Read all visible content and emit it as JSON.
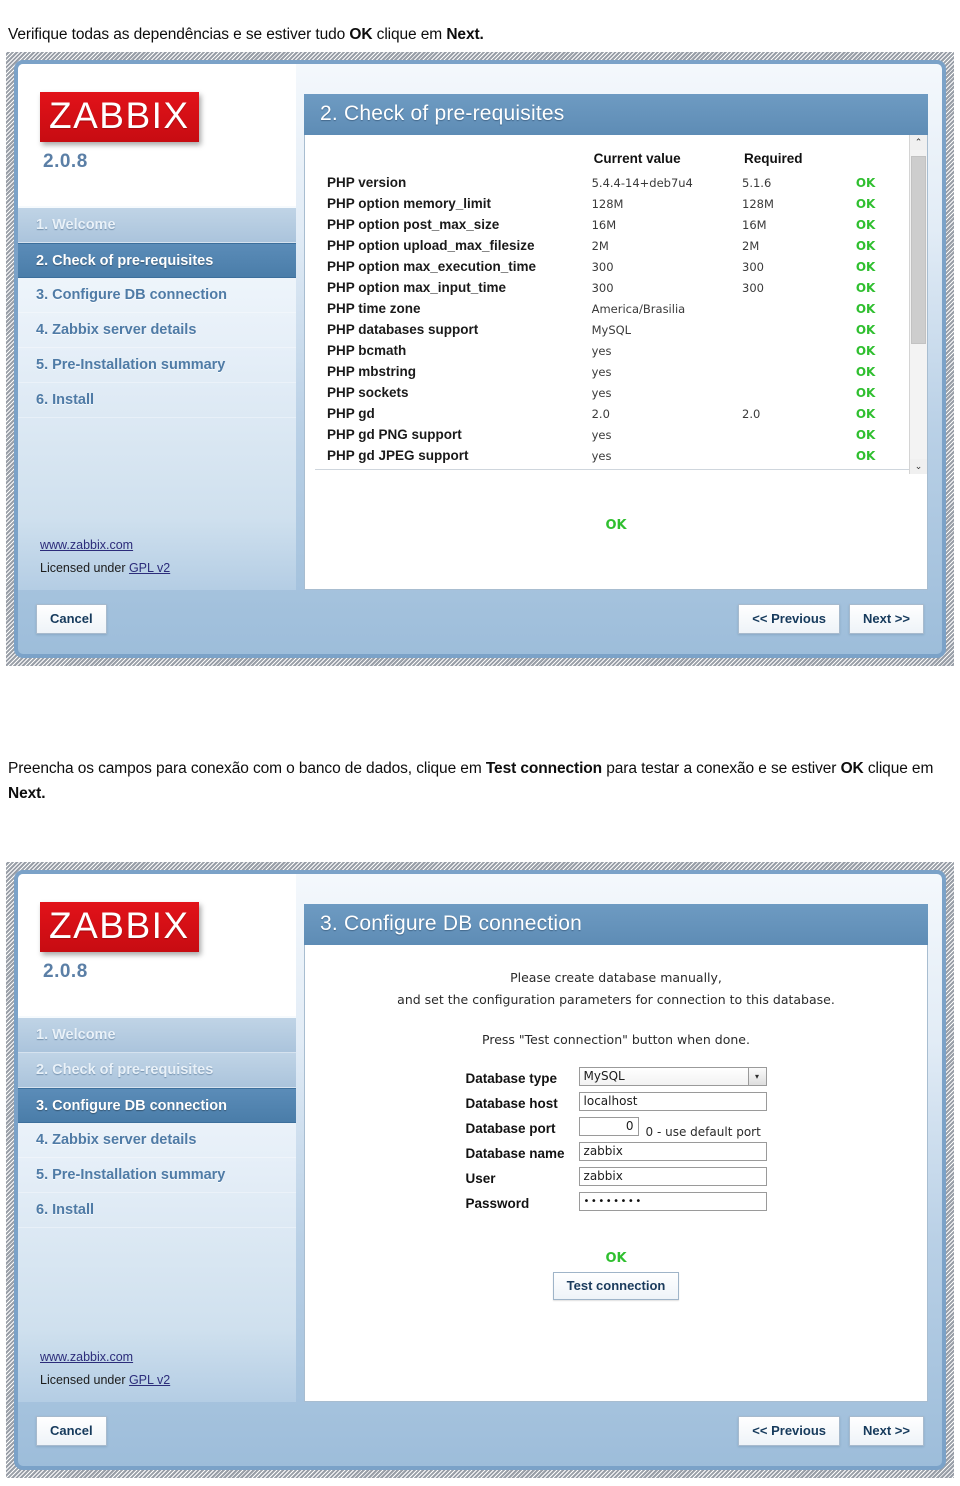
{
  "doc": {
    "para_top_part1": "Verifique todas as dependências e se estiver tudo ",
    "para_top_bold1": "OK",
    "para_top_part2": " clique em ",
    "para_top_bold2": "Next.",
    "para_mid_part1": "Preencha os campos para conexão com o banco de dados, clique em ",
    "para_mid_bold1": "Test connection",
    "para_mid_part2": " para testar a conexão e se estiver ",
    "para_mid_bold2": "OK",
    "para_mid_part3": " clique em ",
    "para_mid_bold3": "Next."
  },
  "brand": {
    "logo_text": "ZABBIX",
    "version": "2.0.8"
  },
  "footer_links": {
    "site": "www.zabbix.com",
    "license_prefix": "Licensed under ",
    "license_link": "GPL v2"
  },
  "buttons": {
    "cancel": "Cancel",
    "previous": "<< Previous",
    "next": "Next >>",
    "test_connection": "Test connection"
  },
  "nav_labels": [
    "1. Welcome",
    "2. Check of pre-requisites",
    "3. Configure DB connection",
    "4. Zabbix server details",
    "5. Pre-Installation summary",
    "6. Install"
  ],
  "window_prereq": {
    "title": "2. Check of pre-requisites",
    "active_index": 1,
    "columns": {
      "name": "",
      "current": "Current value",
      "required": "Required",
      "status": ""
    },
    "rows": [
      {
        "name": "PHP version",
        "current": "5.4.4-14+deb7u4",
        "required": "5.1.6",
        "status": "OK"
      },
      {
        "name": "PHP option memory_limit",
        "current": "128M",
        "required": "128M",
        "status": "OK"
      },
      {
        "name": "PHP option post_max_size",
        "current": "16M",
        "required": "16M",
        "status": "OK"
      },
      {
        "name": "PHP option upload_max_filesize",
        "current": "2M",
        "required": "2M",
        "status": "OK"
      },
      {
        "name": "PHP option max_execution_time",
        "current": "300",
        "required": "300",
        "status": "OK"
      },
      {
        "name": "PHP option max_input_time",
        "current": "300",
        "required": "300",
        "status": "OK"
      },
      {
        "name": "PHP time zone",
        "current": "America/Brasilia",
        "required": "",
        "status": "OK"
      },
      {
        "name": "PHP databases support",
        "current": "MySQL",
        "required": "",
        "status": "OK"
      },
      {
        "name": "PHP bcmath",
        "current": "yes",
        "required": "",
        "status": "OK"
      },
      {
        "name": "PHP mbstring",
        "current": "yes",
        "required": "",
        "status": "OK"
      },
      {
        "name": "PHP sockets",
        "current": "yes",
        "required": "",
        "status": "OK"
      },
      {
        "name": "PHP gd",
        "current": "2.0",
        "required": "2.0",
        "status": "OK"
      },
      {
        "name": "PHP gd PNG support",
        "current": "yes",
        "required": "",
        "status": "OK"
      },
      {
        "name": "PHP gd JPEG support",
        "current": "yes",
        "required": "",
        "status": "OK"
      }
    ],
    "overall_status": "OK",
    "scrollbar": {
      "up": "⌃",
      "down": "⌄"
    }
  },
  "window_dbconf": {
    "title": "3. Configure DB connection",
    "active_index": 2,
    "intro_line1": "Please create database manually,",
    "intro_line2": "and set the configuration parameters for connection to this database.",
    "intro_line3": "Press \"Test connection\" button when done.",
    "fields": [
      {
        "label": "Database type",
        "value": "MySQL",
        "kind": "select",
        "hint": ""
      },
      {
        "label": "Database host",
        "value": "localhost",
        "kind": "text",
        "hint": ""
      },
      {
        "label": "Database port",
        "value": "0",
        "kind": "number",
        "hint": "0 - use default port"
      },
      {
        "label": "Database name",
        "value": "zabbix",
        "kind": "text",
        "hint": ""
      },
      {
        "label": "User",
        "value": "zabbix",
        "kind": "text",
        "hint": ""
      },
      {
        "label": "Password",
        "value": "••••••••",
        "kind": "password",
        "hint": ""
      }
    ],
    "test_status": "OK",
    "dropdown_arrow": "▾"
  },
  "colors": {
    "accent_blue": "#5e8cb5",
    "nav_active": "#4a7da9",
    "logo_red": "#d80f16",
    "status_green": "#2fbf2f",
    "link_blue": "#2c2c7a"
  }
}
